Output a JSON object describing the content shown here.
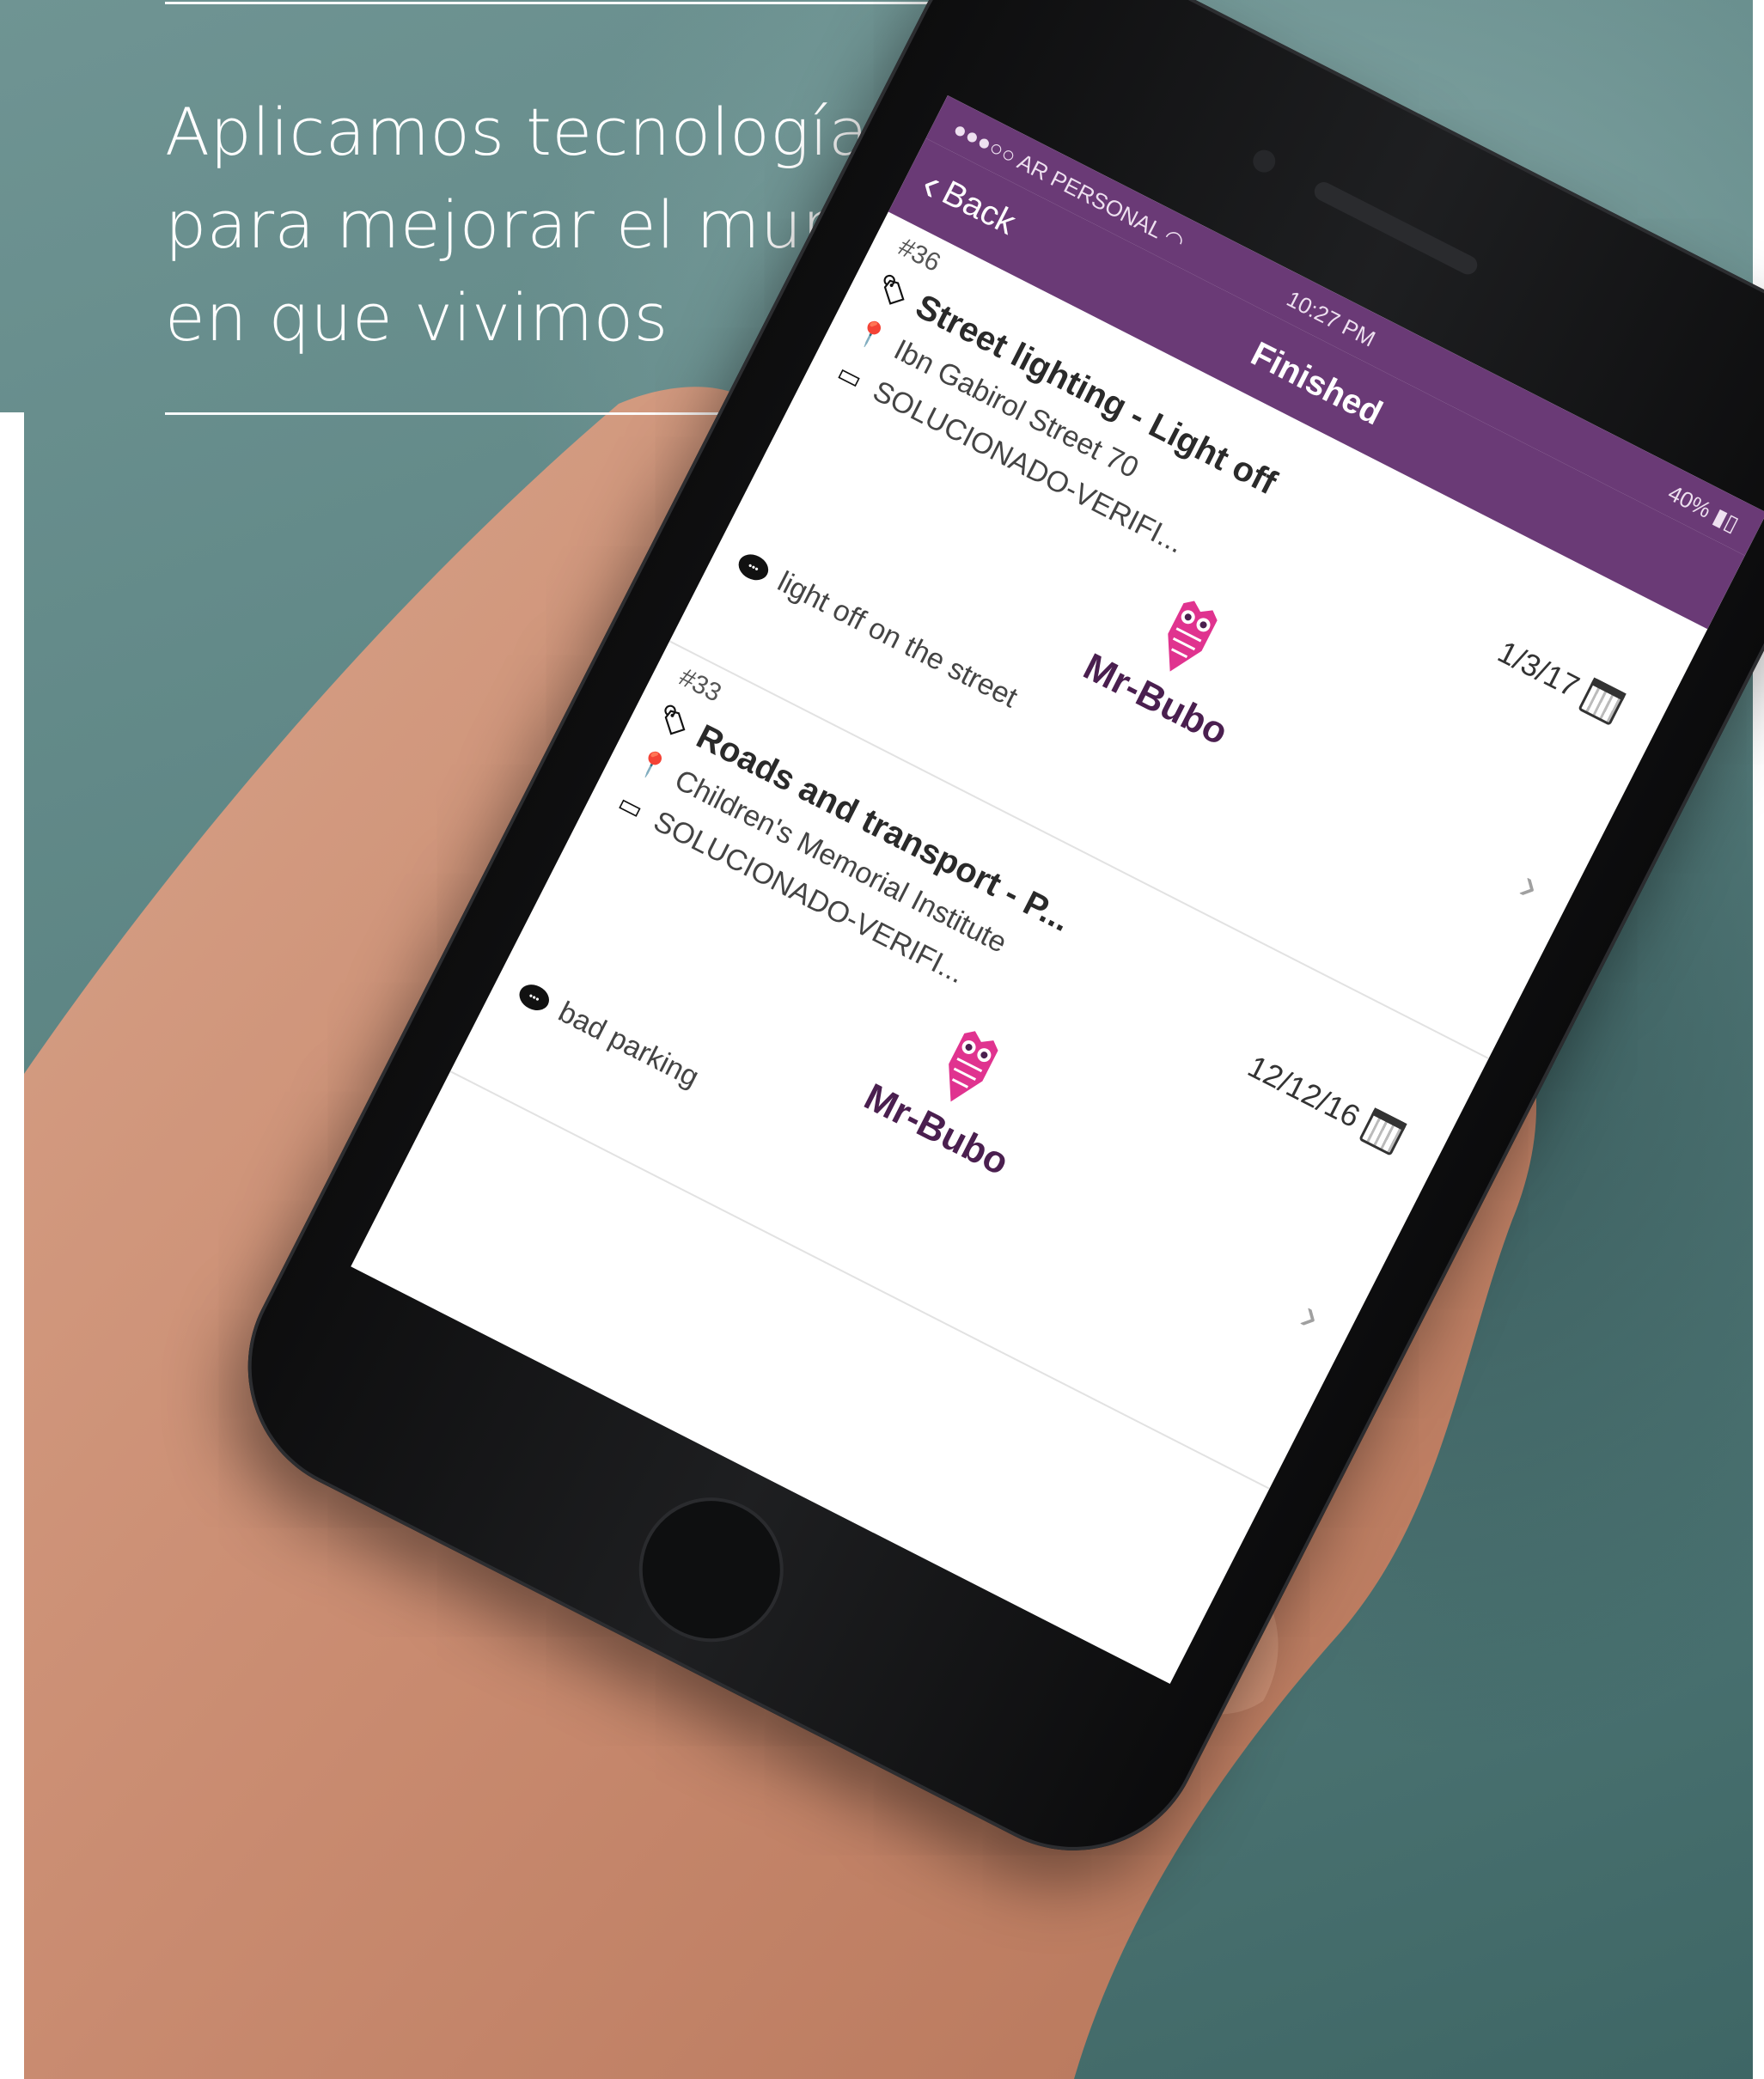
{
  "headline": {
    "lines": [
      "Aplicamos tecnología",
      "para mejorar el mundo",
      "en que vivimos"
    ]
  },
  "status_bar": {
    "carrier": "AR PERSONAL",
    "time": "10:27 PM",
    "battery": "40%"
  },
  "nav": {
    "back_label": "Back",
    "title": "Finished"
  },
  "reports": [
    {
      "number": "#36",
      "title": "Street lighting - Light off",
      "address": "Ibn Gabirol Street 70",
      "status": "SOLUCIONADO-VERIFI...",
      "date": "1/3/17",
      "logo_text": "Mr-Bubo",
      "comment": "light off on the street"
    },
    {
      "number": "#33",
      "title": "Roads and transport  - P...",
      "address": "Children's Memorial Institute",
      "status": "SOLUCIONADO-VERIFI...",
      "date": "12/12/16",
      "logo_text": "Mr-Bubo",
      "comment": "bad parking"
    }
  ],
  "colors": {
    "nav_purple": "#6a3a76",
    "logo_pink": "#e0338f",
    "logo_text": "#4a1f4f",
    "background_teal": "#5d8584"
  },
  "icons": {
    "tag": "tag-icon",
    "location": "location-pin-icon",
    "status": "ticket-icon",
    "calendar": "calendar-icon",
    "comment": "comment-bubble-icon",
    "chevron": "chevron-right-icon",
    "back": "chevron-left-icon"
  }
}
